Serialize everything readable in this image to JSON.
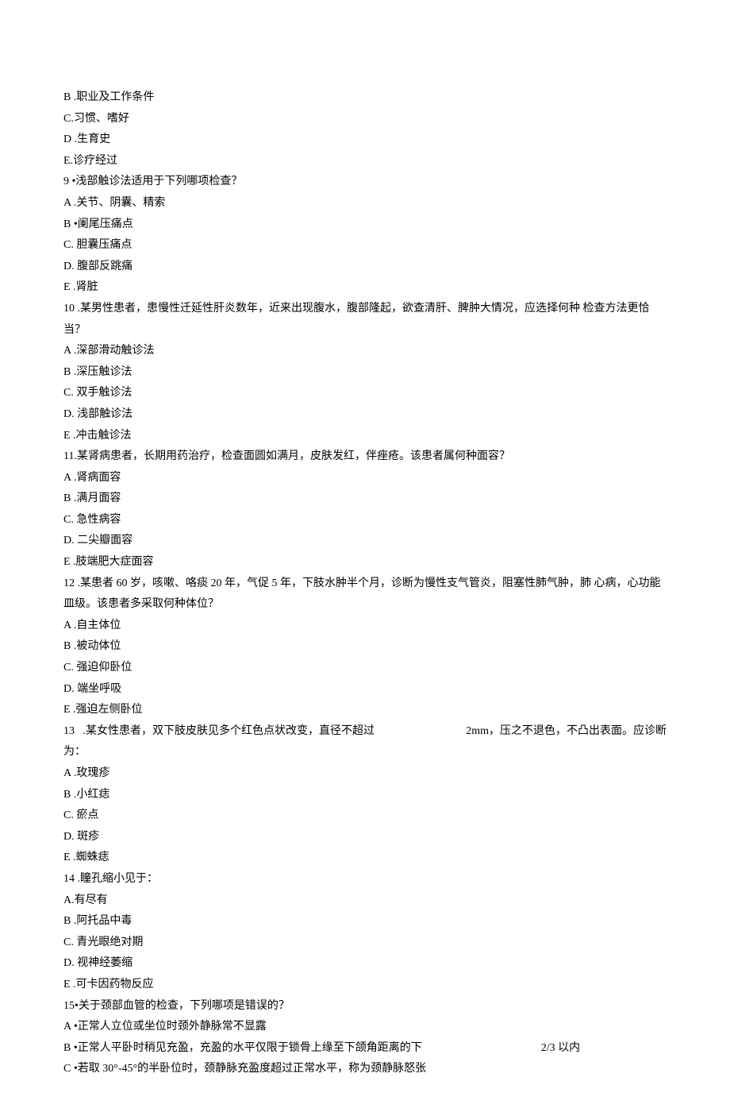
{
  "lines": [
    "B .职业及工作条件",
    "C.习惯、嗜好",
    "D .生育史",
    "E.诊疗经过",
    "9   •浅部触诊法适用于下列哪项检查？",
    "A .关节、阴囊、精索",
    "B •阑尾压痛点",
    "C.    胆囊压痛点",
    "D.    腹部反跳痛",
    "E .肾脏",
    "10   .某男性患者，患慢性迁延性肝炎数年，近来出现腹水，腹部隆起，欲查清肝、脾肿大情况，应选择何种 检查方法更恰当？",
    "A .深部滑动触诊法",
    "B .深压触诊法",
    "C.    双手触诊法",
    "D.    浅部触诊法",
    "E .冲击触诊法",
    "11.某肾病患者，长期用药治疗，检查面圆如满月，皮肤发红，伴痤疮。该患者属何种面容？",
    "A .肾病面容",
    "B .满月面容",
    "C.    急性病容",
    "D.    二尖瓣面容",
    "E .肢端肥大症面容",
    "12   .某患者 60 岁，咳嗽、咯痰 20 年，气促 5 年，下肢水肿半个月，诊断为慢性支气管炎，阻塞性肺气肿，肺 心病，心功能皿级。该患者多采取何种体位？",
    "A .自主体位",
    "B .被动体位",
    "C.    强迫仰卧位",
    "D.    端坐呼吸",
    "E .强迫左侧卧位",
    [
      "13   .某女性患者，双下肢皮肤见多个红色点状改变，直径不超过",
      "2mm，压之不退色，不凸出表面。应诊断"
    ],
    "为：",
    "A .玫瑰疹",
    "B .小红痣",
    "C.    瘀点",
    "D.    斑疹",
    "E .蜘蛛痣",
    "14   .瞳孔缩小见于：",
    "A.有尽有",
    "B .阿托品中毒",
    "C.    青光眼绝对期",
    "D.    视神经萎缩",
    "E .可卡因药物反应",
    "15•关于颈部血管的检查，下列哪项是错误的？",
    "A •正常人立位或坐位时颈外静脉常不显露",
    [
      "B •正常人平卧时稍见充盈，充盈的水平仅限于锁骨上缘至下颌角距离的下",
      "2/3 以内"
    ],
    "C •若取 30°-45°的半卧位时，颈静脉充盈度超过正常水平，称为颈静脉怒张"
  ],
  "gap1": 120,
  "gap2": 150
}
